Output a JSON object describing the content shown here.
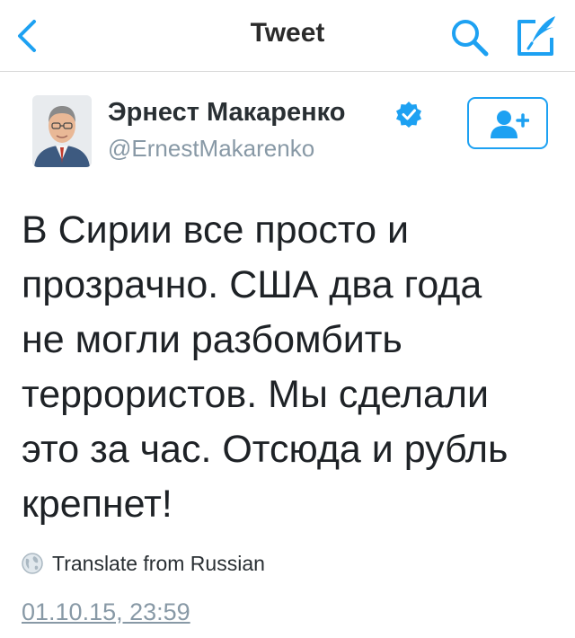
{
  "nav": {
    "title": "Tweet",
    "back_icon": "chevron-left-icon",
    "search_icon": "search-icon",
    "compose_icon": "compose-tweet-icon"
  },
  "author": {
    "name": "Эрнест Макаренко",
    "handle": "@ErnestMakarenko",
    "verified": true,
    "verified_icon": "verified-badge-icon",
    "follow_icon": "follow-user-icon"
  },
  "tweet": {
    "lines": [
      "В Сирии все просто и",
      "прозрачно. США два года",
      "не могли разбомбить",
      "террористов. Мы сделали",
      "это за час. Отсюда и рубль",
      "крепнет!"
    ]
  },
  "translate": {
    "label": "Translate from Russian",
    "icon": "globe-icon"
  },
  "timestamp": "01.10.15, 23:59",
  "colors": {
    "accent": "#1da1f2",
    "verified": "#1da1f2",
    "muted": "#8899a6"
  }
}
